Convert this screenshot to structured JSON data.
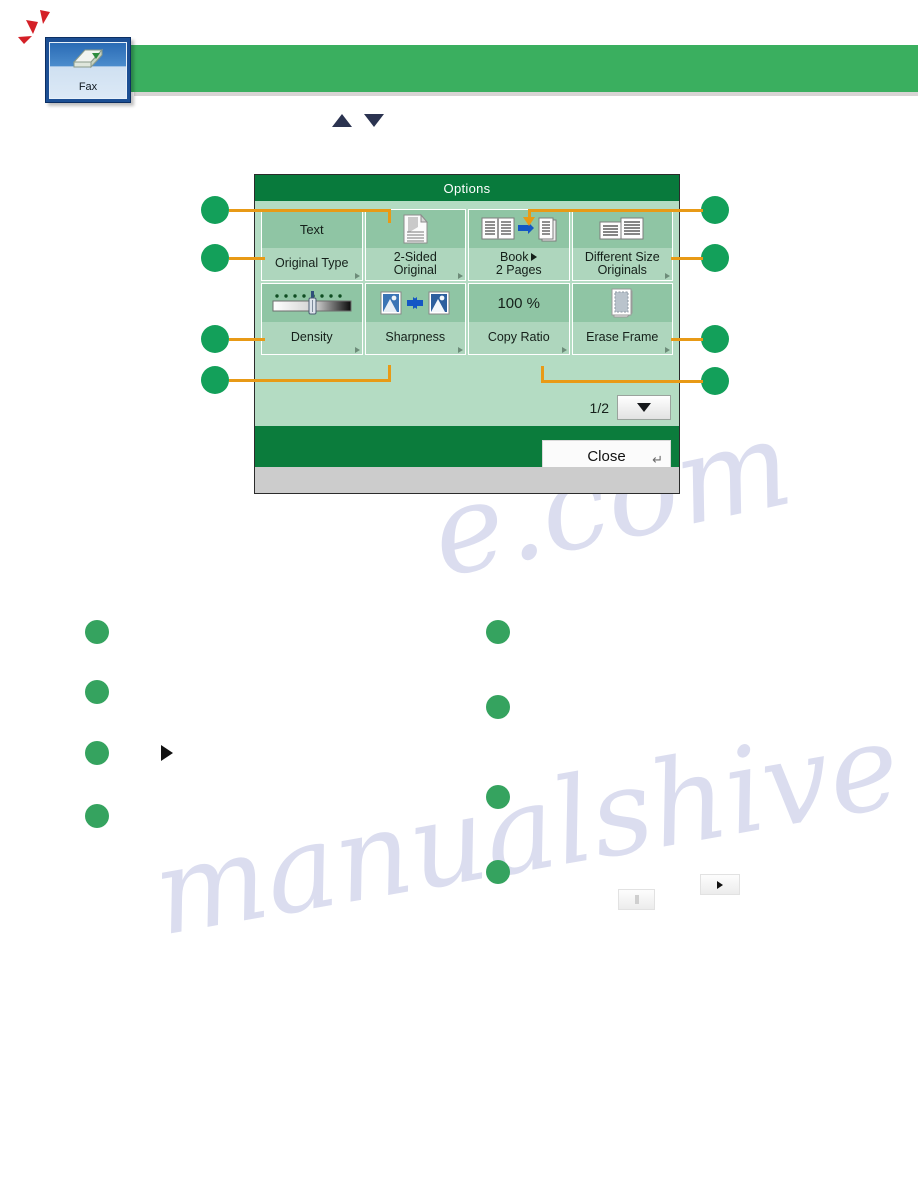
{
  "fax_tile": {
    "label": "Fax",
    "icon": "fax-machine-icon",
    "selected_marker": "red-flash-marker"
  },
  "top_banner": {
    "title": "",
    "color": "#3aaf5f"
  },
  "nav_arrows": {
    "up": "scroll-up-triangle",
    "down": "scroll-down-triangle"
  },
  "screen": {
    "title": "Options",
    "title_bar_color": "#087a3c",
    "body_color": "#b4dcc3",
    "footer_color": "#0b7c3c",
    "buttons": [
      {
        "value": "Text",
        "label": "Original Type",
        "label2": "",
        "icon": "text-value",
        "has_corner_arrow": true
      },
      {
        "value": "",
        "label": "2-Sided",
        "label2": "Original",
        "icon": "two-sided-original-icon",
        "has_corner_arrow": true
      },
      {
        "value": "",
        "label": "Book",
        "label2": "2 Pages",
        "icon": "book-to-two-pages-icon",
        "has_corner_arrow": false,
        "inline_arrow_after_label": true
      },
      {
        "value": "",
        "label": "Different Size",
        "label2": "Originals",
        "icon": "different-size-originals-icon",
        "has_corner_arrow": true
      },
      {
        "value": "",
        "label": "Density",
        "label2": "",
        "icon": "density-slider-icon",
        "has_corner_arrow": true
      },
      {
        "value": "",
        "label": "Sharpness",
        "label2": "",
        "icon": "sharpness-icon",
        "has_corner_arrow": true
      },
      {
        "value": "100 %",
        "label": "Copy Ratio",
        "label2": "",
        "icon": "copy-ratio-value",
        "has_corner_arrow": true
      },
      {
        "value": "",
        "label": "Erase Frame",
        "label2": "",
        "icon": "erase-frame-icon",
        "has_corner_arrow": true
      }
    ],
    "pager": {
      "label": "1/2",
      "down_icon": "page-down-triangle"
    },
    "close_button": {
      "label": "Close",
      "enter_glyph": "↵"
    }
  },
  "callouts": {
    "accent_color": "#e89a16",
    "dot_color": "#13a05a",
    "left": [
      {
        "name": "callout-left-1",
        "label": ""
      },
      {
        "name": "callout-left-2",
        "label": ""
      },
      {
        "name": "callout-left-3",
        "label": ""
      },
      {
        "name": "callout-left-4",
        "label": ""
      }
    ],
    "right": [
      {
        "name": "callout-right-1",
        "label": ""
      },
      {
        "name": "callout-right-2",
        "label": ""
      },
      {
        "name": "callout-right-3",
        "label": ""
      },
      {
        "name": "callout-right-4",
        "label": ""
      }
    ]
  },
  "body_notes": {
    "left_column": [
      {
        "bullet": "note-bullet-1",
        "text": ""
      },
      {
        "bullet": "note-bullet-2",
        "text": ""
      },
      {
        "bullet": "note-bullet-3",
        "text": "",
        "inline_icon": "right-triangle-icon"
      },
      {
        "bullet": "note-bullet-4",
        "text": ""
      }
    ],
    "right_column": [
      {
        "bullet": "note-bullet-5",
        "text": ""
      },
      {
        "bullet": "note-bullet-6",
        "text": ""
      },
      {
        "bullet": "note-bullet-7",
        "text": ""
      },
      {
        "bullet": "note-bullet-8",
        "text": "",
        "inline_buttons": [
          "mini-blank-button",
          "mini-arrow-button"
        ]
      }
    ]
  },
  "watermark": {
    "line_a": "e.com",
    "line_b": "manualshive"
  }
}
